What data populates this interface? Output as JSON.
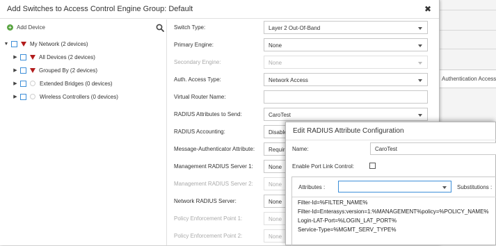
{
  "background": {
    "auth_tab_label": "Authentication Access"
  },
  "dialog": {
    "title": "Add Switches to Access Control Engine Group: Default",
    "close_glyph": "✖",
    "add_device_label": "Add Device",
    "tree": [
      {
        "label": "My Network (2 devices)",
        "level": 0,
        "marker": "red-triangle"
      },
      {
        "label": "All Devices (2 devices)",
        "level": 1,
        "marker": "red-triangle"
      },
      {
        "label": "Grouped By (2 devices)",
        "level": 1,
        "marker": "red-triangle"
      },
      {
        "label": "Extended Bridges (0 devices)",
        "level": 1,
        "marker": "circle"
      },
      {
        "label": "Wireless Controllers (0 devices)",
        "level": 1,
        "marker": "circle"
      }
    ],
    "form": {
      "switch_type": {
        "label": "Switch Type:",
        "value": "Layer 2 Out-Of-Band"
      },
      "primary_engine": {
        "label": "Primary Engine:",
        "value": "None"
      },
      "secondary_engine": {
        "label": "Secondary Engine:",
        "value": "None"
      },
      "auth_access_type": {
        "label": "Auth. Access Type:",
        "value": "Network Access"
      },
      "virtual_router_name": {
        "label": "Virtual Router Name:",
        "value": ""
      },
      "radius_attributes": {
        "label": "RADIUS Attributes to Send:",
        "value": "CaroTest"
      },
      "radius_accounting": {
        "label": "RADIUS Accounting:",
        "value": "Disable"
      },
      "message_authenticator": {
        "label": "Message-Authenticator Attribute:",
        "value": "Require"
      },
      "mgmt_radius_1": {
        "label": "Management RADIUS Server 1:",
        "value": "None"
      },
      "mgmt_radius_2": {
        "label": "Management RADIUS Server 2:",
        "value": "None"
      },
      "network_radius": {
        "label": "Network RADIUS Server:",
        "value": "None"
      },
      "pep_1": {
        "label": "Policy Enforcement Point 1:",
        "value": "None"
      },
      "pep_2": {
        "label": "Policy Enforcement Point 2:",
        "value": "None"
      }
    }
  },
  "edit_radius": {
    "title": "Edit RADIUS Attribute Configuration",
    "name_label": "Name:",
    "name_value": "CaroTest",
    "port_link_label": "Enable Port Link Control:",
    "port_link_checked": false,
    "attributes_label": "Attributes :",
    "attributes_value": "",
    "substitutions_label": "Substitutions :",
    "lines": [
      "Filter-Id=%FILTER_NAME%",
      "Filter-Id=Enterasys:version=1:%MANAGEMENT%policy=%POLICY_NAME%",
      "Login-LAT-Port=%LOGIN_LAT_PORT%",
      "Service-Type=%MGMT_SERV_TYPE%"
    ]
  },
  "colors": {
    "accent_blue": "#3c8ed8",
    "add_green": "#5aa542",
    "tree_red": "#b21c1c"
  }
}
